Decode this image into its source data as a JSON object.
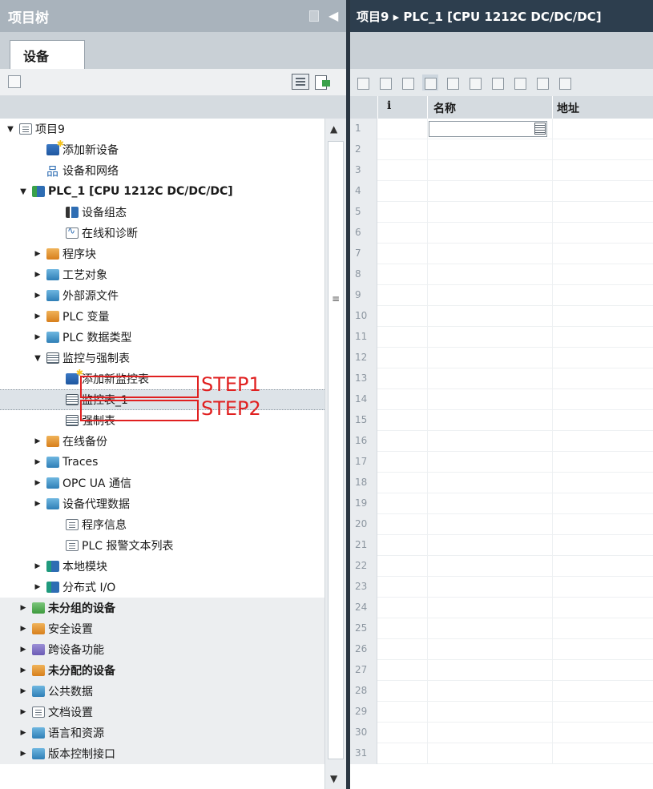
{
  "left_panel": {
    "title": "项目树",
    "tab": "设备"
  },
  "right_panel": {
    "breadcrumb": "项目9 ▸ PLC_1 [CPU 1212C DC/DC/DC]",
    "columns": {
      "info": "i",
      "name": "名称",
      "address": "地址"
    },
    "row_numbers": [
      "1",
      "2",
      "3",
      "4",
      "5",
      "6",
      "7",
      "8",
      "9",
      "10",
      "11",
      "12",
      "13",
      "14",
      "15",
      "16",
      "17",
      "18",
      "19",
      "20",
      "21",
      "22",
      "23",
      "24",
      "25",
      "26",
      "27",
      "28",
      "29",
      "30",
      "31"
    ]
  },
  "tree": [
    {
      "label": "项目9",
      "indent": 0,
      "arrow": "▼",
      "icon": "doc-icon",
      "bold": false
    },
    {
      "label": "添加新设备",
      "indent": 2,
      "arrow": "",
      "icon": "add-device-icon",
      "bold": false
    },
    {
      "label": "设备和网络",
      "indent": 2,
      "arrow": "",
      "icon": "network-icon",
      "bold": false
    },
    {
      "label": "PLC_1 [CPU 1212C DC/DC/DC]",
      "indent": 1,
      "arrow": "▼",
      "icon": "plc-icon",
      "bold": true
    },
    {
      "label": "设备组态",
      "indent": 3,
      "arrow": "",
      "icon": "device-config-icon",
      "bold": false
    },
    {
      "label": "在线和诊断",
      "indent": 3,
      "arrow": "",
      "icon": "diagnostics-icon",
      "bold": false
    },
    {
      "label": "程序块",
      "indent": 2,
      "arrow": "▶",
      "icon": "program-blocks-icon",
      "bold": false
    },
    {
      "label": "工艺对象",
      "indent": 2,
      "arrow": "▶",
      "icon": "technology-objects-icon",
      "bold": false
    },
    {
      "label": "外部源文件",
      "indent": 2,
      "arrow": "▶",
      "icon": "external-source-icon",
      "bold": false
    },
    {
      "label": "PLC 变量",
      "indent": 2,
      "arrow": "▶",
      "icon": "plc-tags-icon",
      "bold": false
    },
    {
      "label": "PLC 数据类型",
      "indent": 2,
      "arrow": "▶",
      "icon": "plc-datatypes-icon",
      "bold": false
    },
    {
      "label": "监控与强制表",
      "indent": 2,
      "arrow": "▼",
      "icon": "watch-tables-icon",
      "bold": false
    },
    {
      "label": "添加新监控表",
      "indent": 3,
      "arrow": "",
      "icon": "add-watch-table-icon",
      "bold": false
    },
    {
      "label": "监控表_1",
      "indent": 3,
      "arrow": "",
      "icon": "watch-table-icon",
      "bold": false,
      "selected": true
    },
    {
      "label": "强制表",
      "indent": 3,
      "arrow": "",
      "icon": "force-table-icon",
      "bold": false
    },
    {
      "label": "在线备份",
      "indent": 2,
      "arrow": "▶",
      "icon": "online-backup-icon",
      "bold": false
    },
    {
      "label": "Traces",
      "indent": 2,
      "arrow": "▶",
      "icon": "traces-icon",
      "bold": false
    },
    {
      "label": "OPC UA 通信",
      "indent": 2,
      "arrow": "▶",
      "icon": "opcua-icon",
      "bold": false
    },
    {
      "label": "设备代理数据",
      "indent": 2,
      "arrow": "▶",
      "icon": "device-proxy-icon",
      "bold": false
    },
    {
      "label": "程序信息",
      "indent": 3,
      "arrow": "",
      "icon": "program-info-icon",
      "bold": false
    },
    {
      "label": "PLC 报警文本列表",
      "indent": 3,
      "arrow": "",
      "icon": "alarm-text-icon",
      "bold": false
    },
    {
      "label": "本地模块",
      "indent": 2,
      "arrow": "▶",
      "icon": "local-modules-icon",
      "bold": false
    },
    {
      "label": "分布式 I/O",
      "indent": 2,
      "arrow": "▶",
      "icon": "distributed-io-icon",
      "bold": false
    },
    {
      "label": "未分组的设备",
      "indent": 1,
      "arrow": "▶",
      "icon": "ungrouped-devices-icon",
      "bold": true,
      "grey": true
    },
    {
      "label": "安全设置",
      "indent": 1,
      "arrow": "▶",
      "icon": "security-settings-icon",
      "bold": false,
      "grey": true
    },
    {
      "label": "跨设备功能",
      "indent": 1,
      "arrow": "▶",
      "icon": "cross-device-icon",
      "bold": false,
      "grey": true
    },
    {
      "label": "未分配的设备",
      "indent": 1,
      "arrow": "▶",
      "icon": "unassigned-devices-icon",
      "bold": true,
      "grey": true
    },
    {
      "label": "公共数据",
      "indent": 1,
      "arrow": "▶",
      "icon": "common-data-icon",
      "bold": false,
      "grey": true
    },
    {
      "label": "文档设置",
      "indent": 1,
      "arrow": "▶",
      "icon": "doc-settings-icon",
      "bold": false,
      "grey": true
    },
    {
      "label": "语言和资源",
      "indent": 1,
      "arrow": "▶",
      "icon": "languages-icon",
      "bold": false,
      "grey": true
    },
    {
      "label": "版本控制接口",
      "indent": 1,
      "arrow": "▶",
      "icon": "version-control-icon",
      "bold": false,
      "grey": true
    }
  ],
  "annotations": {
    "step1": "STEP1",
    "step2": "STEP2"
  },
  "colors": {
    "title_bar_left": "#a9b3bc",
    "title_bar_right": "#2d3e4e",
    "annotation_red": "#e02020"
  }
}
